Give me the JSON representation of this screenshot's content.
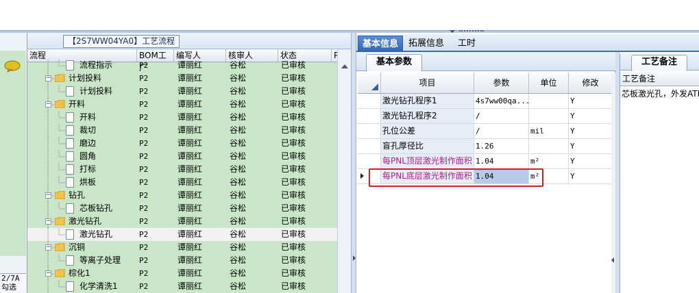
{
  "process_panel": {
    "title": "【2S7WW04YA0】工艺流程",
    "columns": [
      "流程",
      "BOM工厂",
      "编写人",
      "核审人",
      "状态",
      "P"
    ]
  },
  "left_strip": {
    "code_line1": "2/7A",
    "code_line2": "勾选"
  },
  "tree_rows": [
    {
      "name": "流程指示",
      "level": 2,
      "type": "doc",
      "factory": "P2",
      "writer": "谭丽红",
      "reviewer": "谷松",
      "status": "已审核"
    },
    {
      "name": "计划投料",
      "level": 1,
      "type": "folder",
      "factory": "P2",
      "writer": "谭丽红",
      "reviewer": "谷松",
      "status": "已审核"
    },
    {
      "name": "计划投料",
      "level": 2,
      "type": "doc",
      "factory": "P2",
      "writer": "谭丽红",
      "reviewer": "谷松",
      "status": "已审核"
    },
    {
      "name": "开料",
      "level": 1,
      "type": "folder",
      "factory": "P2",
      "writer": "谭丽红",
      "reviewer": "谷松",
      "status": "已审核"
    },
    {
      "name": "开料",
      "level": 2,
      "type": "doc",
      "factory": "P2",
      "writer": "谭丽红",
      "reviewer": "谷松",
      "status": "已审核"
    },
    {
      "name": "裁切",
      "level": 2,
      "type": "doc",
      "factory": "P2",
      "writer": "谭丽红",
      "reviewer": "谷松",
      "status": "已审核"
    },
    {
      "name": "磨边",
      "level": 2,
      "type": "doc",
      "factory": "P2",
      "writer": "谭丽红",
      "reviewer": "谷松",
      "status": "已审核"
    },
    {
      "name": "圆角",
      "level": 2,
      "type": "doc",
      "factory": "P2",
      "writer": "谭丽红",
      "reviewer": "谷松",
      "status": "已审核"
    },
    {
      "name": "打标",
      "level": 2,
      "type": "doc",
      "factory": "P2",
      "writer": "谭丽红",
      "reviewer": "谷松",
      "status": "已审核"
    },
    {
      "name": "烘板",
      "level": 2,
      "type": "doc",
      "factory": "P2",
      "writer": "谭丽红",
      "reviewer": "谷松",
      "status": "已审核"
    },
    {
      "name": "钻孔",
      "level": 1,
      "type": "folder",
      "factory": "P2",
      "writer": "谭丽红",
      "reviewer": "谷松",
      "status": "已审核"
    },
    {
      "name": "芯板钻孔",
      "level": 2,
      "type": "doc",
      "factory": "P2",
      "writer": "谭丽红",
      "reviewer": "谷松",
      "status": "已审核"
    },
    {
      "name": "激光钻孔",
      "level": 1,
      "type": "folder",
      "factory": "P2",
      "writer": "谭丽红",
      "reviewer": "谷松",
      "status": "已审核"
    },
    {
      "name": "激光钻孔",
      "level": 2,
      "type": "doc",
      "factory": "P2",
      "writer": "谭丽红",
      "reviewer": "谷松",
      "status": "已审核",
      "selected": true
    },
    {
      "name": "沉铜",
      "level": 1,
      "type": "folder",
      "factory": "P2",
      "writer": "谭丽红",
      "reviewer": "谷松",
      "status": "已审核"
    },
    {
      "name": "等离子处理",
      "level": 2,
      "type": "doc",
      "factory": "P2",
      "writer": "谭丽红",
      "reviewer": "谷松",
      "status": "已审核"
    },
    {
      "name": "棕化1",
      "level": 1,
      "type": "folder",
      "factory": "P2",
      "writer": "谭丽红",
      "reviewer": "谷松",
      "status": "已审核"
    },
    {
      "name": "化学清洗1",
      "level": 2,
      "type": "doc",
      "factory": "P2",
      "writer": "谭丽红",
      "reviewer": "谷松",
      "status": "已审核"
    }
  ],
  "top_tabs": [
    {
      "label": "基本信息",
      "active": true
    },
    {
      "label": "拓展信息",
      "active": false
    },
    {
      "label": "工时",
      "active": false
    }
  ],
  "param_panel": {
    "tab_label": "基本参数",
    "columns": [
      "项目",
      "参数",
      "单位",
      "修改"
    ],
    "rows": [
      {
        "item": "激光钻孔程序1",
        "param": "4s7ww00qa...",
        "unit": "",
        "modify": "Y",
        "magenta": false
      },
      {
        "item": "激光钻孔程序2",
        "param": "/",
        "unit": "",
        "modify": "Y",
        "magenta": false
      },
      {
        "item": "孔位公差",
        "param": "/",
        "unit": "mil",
        "modify": "Y",
        "magenta": false
      },
      {
        "item": "盲孔厚径比",
        "param": "1.26",
        "unit": "",
        "modify": "Y",
        "magenta": false
      },
      {
        "item": "每PNL顶层激光制作面积",
        "param": "1.04",
        "unit": "m²",
        "modify": "Y",
        "magenta": true
      },
      {
        "item": "每PNL底层激光制作面积",
        "param": "1.04",
        "unit": "m²",
        "modify": "Y",
        "magenta": true,
        "current": true
      }
    ]
  },
  "remark_panel": {
    "tab_label": "工艺备注",
    "column": "工艺备注",
    "text": "芯板激光孔，外发ATE"
  },
  "colors": {
    "tree_bg": "#c9e6c9",
    "accent_blue": "#2f64b2",
    "highlight_red": "#d02020",
    "magenta_text": "#b0208a"
  }
}
